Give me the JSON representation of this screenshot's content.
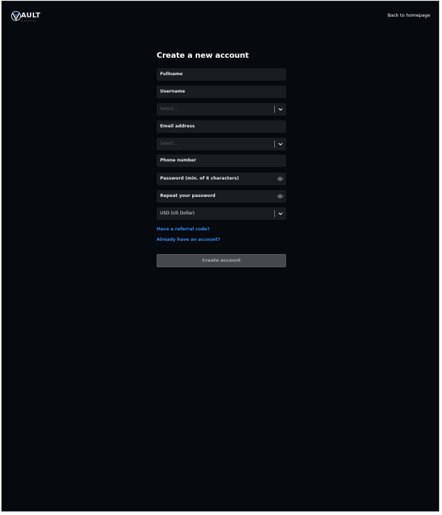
{
  "brand": {
    "name": "AULT",
    "tagline": "CAPITAL",
    "accent_color": "#3b82f6",
    "logo_icon": "v-shield-logo"
  },
  "header": {
    "back_link": "Back to homepage"
  },
  "form": {
    "title": "Create a new account",
    "fields": {
      "fullname": "Fullname",
      "username": "Username",
      "select_1": "Select...",
      "email": "Email address",
      "select_2": "Select...",
      "phone": "Phone number",
      "password": "Password (min. of 6 characters)",
      "repeat_password": "Repeat your password",
      "currency": "USD (US Dollar)"
    },
    "icons": {
      "chevron": "chevron-down-icon",
      "eye": "eye-icon"
    },
    "links": {
      "referral": "Have a referral code?",
      "login": "Already have an account?"
    },
    "submit_label": "Create account"
  },
  "colors": {
    "background": "#06090d",
    "field_background": "#191c20",
    "link": "#2f8ff6",
    "button": "#45484c"
  }
}
